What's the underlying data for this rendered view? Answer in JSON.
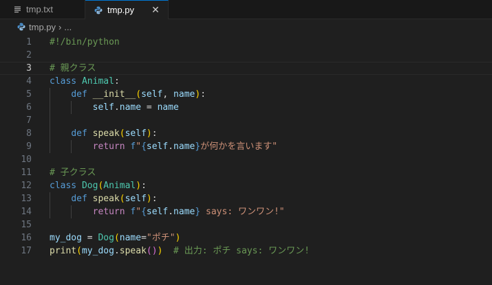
{
  "tabs": [
    {
      "label": "tmp.txt",
      "icon": "text-file-icon",
      "active": false
    },
    {
      "label": "tmp.py",
      "icon": "python-icon",
      "active": true,
      "close": "✕"
    }
  ],
  "breadcrumb": {
    "file": "tmp.py",
    "separator": "›",
    "more": "..."
  },
  "colors": {
    "accent": "#0078d4",
    "background": "#1f1f1f"
  },
  "current_line": 3,
  "lines": [
    {
      "n": "1",
      "tokens": [
        {
          "t": "#!/bin/python",
          "c": "tk-comment"
        }
      ]
    },
    {
      "n": "2",
      "tokens": []
    },
    {
      "n": "3",
      "tokens": [
        {
          "t": "# 親クラス",
          "c": "tk-comment"
        }
      ]
    },
    {
      "n": "4",
      "tokens": [
        {
          "t": "class",
          "c": "tk-kw"
        },
        {
          "t": " ",
          "c": "tk-op"
        },
        {
          "t": "Animal",
          "c": "tk-cls"
        },
        {
          "t": ":",
          "c": "tk-op"
        }
      ]
    },
    {
      "n": "5",
      "guides": 1,
      "tokens": [
        {
          "t": "    ",
          "c": "tk-op"
        },
        {
          "t": "def",
          "c": "tk-kw"
        },
        {
          "t": " ",
          "c": "tk-op"
        },
        {
          "t": "__init__",
          "c": "tk-fn"
        },
        {
          "t": "(",
          "c": "tk-br1"
        },
        {
          "t": "self",
          "c": "tk-var"
        },
        {
          "t": ", ",
          "c": "tk-op"
        },
        {
          "t": "name",
          "c": "tk-var"
        },
        {
          "t": ")",
          "c": "tk-br1"
        },
        {
          "t": ":",
          "c": "tk-op"
        }
      ]
    },
    {
      "n": "6",
      "guides": 2,
      "tokens": [
        {
          "t": "        ",
          "c": "tk-op"
        },
        {
          "t": "self",
          "c": "tk-var"
        },
        {
          "t": ".",
          "c": "tk-op"
        },
        {
          "t": "name",
          "c": "tk-var"
        },
        {
          "t": " = ",
          "c": "tk-op"
        },
        {
          "t": "name",
          "c": "tk-var"
        }
      ]
    },
    {
      "n": "7",
      "guides": 1,
      "tokens": []
    },
    {
      "n": "8",
      "guides": 1,
      "tokens": [
        {
          "t": "    ",
          "c": "tk-op"
        },
        {
          "t": "def",
          "c": "tk-kw"
        },
        {
          "t": " ",
          "c": "tk-op"
        },
        {
          "t": "speak",
          "c": "tk-fn"
        },
        {
          "t": "(",
          "c": "tk-br1"
        },
        {
          "t": "self",
          "c": "tk-var"
        },
        {
          "t": ")",
          "c": "tk-br1"
        },
        {
          "t": ":",
          "c": "tk-op"
        }
      ]
    },
    {
      "n": "9",
      "guides": 2,
      "tokens": [
        {
          "t": "        ",
          "c": "tk-op"
        },
        {
          "t": "return",
          "c": "tk-kw2"
        },
        {
          "t": " ",
          "c": "tk-op"
        },
        {
          "t": "f",
          "c": "tk-kw"
        },
        {
          "t": "\"",
          "c": "tk-str"
        },
        {
          "t": "{",
          "c": "tk-esc"
        },
        {
          "t": "self",
          "c": "tk-var"
        },
        {
          "t": ".",
          "c": "tk-op"
        },
        {
          "t": "name",
          "c": "tk-var"
        },
        {
          "t": "}",
          "c": "tk-esc"
        },
        {
          "t": "が何かを言います\"",
          "c": "tk-str"
        }
      ]
    },
    {
      "n": "10",
      "tokens": []
    },
    {
      "n": "11",
      "tokens": [
        {
          "t": "# 子クラス",
          "c": "tk-comment"
        }
      ]
    },
    {
      "n": "12",
      "tokens": [
        {
          "t": "class",
          "c": "tk-kw"
        },
        {
          "t": " ",
          "c": "tk-op"
        },
        {
          "t": "Dog",
          "c": "tk-cls"
        },
        {
          "t": "(",
          "c": "tk-br1"
        },
        {
          "t": "Animal",
          "c": "tk-cls"
        },
        {
          "t": ")",
          "c": "tk-br1"
        },
        {
          "t": ":",
          "c": "tk-op"
        }
      ]
    },
    {
      "n": "13",
      "guides": 1,
      "tokens": [
        {
          "t": "    ",
          "c": "tk-op"
        },
        {
          "t": "def",
          "c": "tk-kw"
        },
        {
          "t": " ",
          "c": "tk-op"
        },
        {
          "t": "speak",
          "c": "tk-fn"
        },
        {
          "t": "(",
          "c": "tk-br1"
        },
        {
          "t": "self",
          "c": "tk-var"
        },
        {
          "t": ")",
          "c": "tk-br1"
        },
        {
          "t": ":",
          "c": "tk-op"
        }
      ]
    },
    {
      "n": "14",
      "guides": 2,
      "tokens": [
        {
          "t": "        ",
          "c": "tk-op"
        },
        {
          "t": "return",
          "c": "tk-kw2"
        },
        {
          "t": " ",
          "c": "tk-op"
        },
        {
          "t": "f",
          "c": "tk-kw"
        },
        {
          "t": "\"",
          "c": "tk-str"
        },
        {
          "t": "{",
          "c": "tk-esc"
        },
        {
          "t": "self",
          "c": "tk-var"
        },
        {
          "t": ".",
          "c": "tk-op"
        },
        {
          "t": "name",
          "c": "tk-var"
        },
        {
          "t": "}",
          "c": "tk-esc"
        },
        {
          "t": " says: ワンワン!\"",
          "c": "tk-str"
        }
      ]
    },
    {
      "n": "15",
      "tokens": []
    },
    {
      "n": "16",
      "tokens": [
        {
          "t": "my_dog",
          "c": "tk-var"
        },
        {
          "t": " = ",
          "c": "tk-op"
        },
        {
          "t": "Dog",
          "c": "tk-cls"
        },
        {
          "t": "(",
          "c": "tk-br1"
        },
        {
          "t": "name",
          "c": "tk-var"
        },
        {
          "t": "=",
          "c": "tk-op"
        },
        {
          "t": "\"ポチ\"",
          "c": "tk-str"
        },
        {
          "t": ")",
          "c": "tk-br1"
        }
      ]
    },
    {
      "n": "17",
      "tokens": [
        {
          "t": "print",
          "c": "tk-fn"
        },
        {
          "t": "(",
          "c": "tk-br1"
        },
        {
          "t": "my_dog",
          "c": "tk-var"
        },
        {
          "t": ".",
          "c": "tk-op"
        },
        {
          "t": "speak",
          "c": "tk-fn"
        },
        {
          "t": "(",
          "c": "tk-br2"
        },
        {
          "t": ")",
          "c": "tk-br2"
        },
        {
          "t": ")",
          "c": "tk-br1"
        },
        {
          "t": "  ",
          "c": "tk-op"
        },
        {
          "t": "# 出力: ポチ says: ワンワン!",
          "c": "tk-comment"
        }
      ]
    }
  ]
}
